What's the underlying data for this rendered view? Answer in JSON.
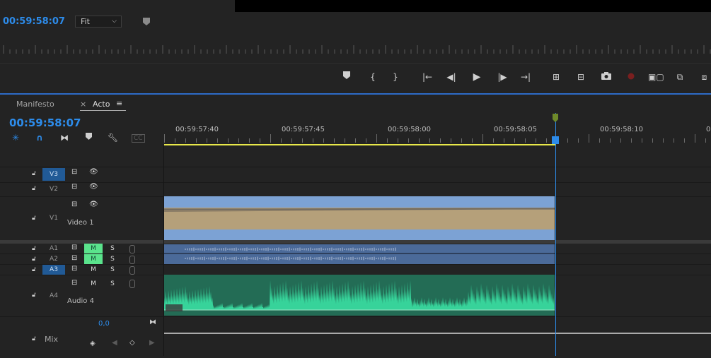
{
  "monitor": {
    "timecode": "00:59:58:07",
    "zoom_select": "Fit",
    "transport": [
      "add-marker",
      "mark-in",
      "mark-out",
      "go-to-in",
      "step-back",
      "play",
      "step-forward",
      "go-to-out",
      "lift",
      "extract",
      "export-frame",
      "record",
      "comparison-view",
      "insert",
      "overwrite"
    ]
  },
  "timeline": {
    "tabs": [
      {
        "label": "Manifesto",
        "active": false
      },
      {
        "label": "Acto",
        "active": true
      }
    ],
    "close_glyph": "×",
    "menu_glyph": "≡",
    "timecode": "00:59:58:07",
    "ruler_labels": [
      "00:59:57:40",
      "00:59:57:45",
      "00:59:58:00",
      "00:59:58:05",
      "00:59:58:10",
      "0"
    ],
    "tools": [
      "snap-icon",
      "linked-selection-icon",
      "insert-overwrite-icon",
      "add-marker-icon",
      "settings-wrench-icon",
      "captions-icon"
    ]
  },
  "tracks": {
    "video": [
      {
        "id": "V3",
        "targeted": true,
        "label": ""
      },
      {
        "id": "V2",
        "targeted": false,
        "label": ""
      },
      {
        "id": "V1",
        "targeted": false,
        "label": "Video 1"
      }
    ],
    "audio": [
      {
        "id": "A1",
        "targeted": false,
        "mute": "M",
        "mute_on": true,
        "solo": "S",
        "label": ""
      },
      {
        "id": "A2",
        "targeted": false,
        "mute": "M",
        "mute_on": true,
        "solo": "S",
        "label": ""
      },
      {
        "id": "A3",
        "targeted": true,
        "mute": "M",
        "mute_on": false,
        "solo": "S",
        "label": ""
      },
      {
        "id": "A4",
        "targeted": false,
        "mute": "M",
        "mute_on": false,
        "solo": "S",
        "label": "Audio 4"
      }
    ],
    "mix": {
      "label": "Mix",
      "value": "0,0"
    }
  },
  "colors": {
    "accent": "#2d8ceb",
    "video_clip": "#7ca2d4",
    "audio_clip": "#236c55",
    "waveform": "#37d39a",
    "workbar": "#e8e84a",
    "mute_on": "#5ae38c"
  }
}
